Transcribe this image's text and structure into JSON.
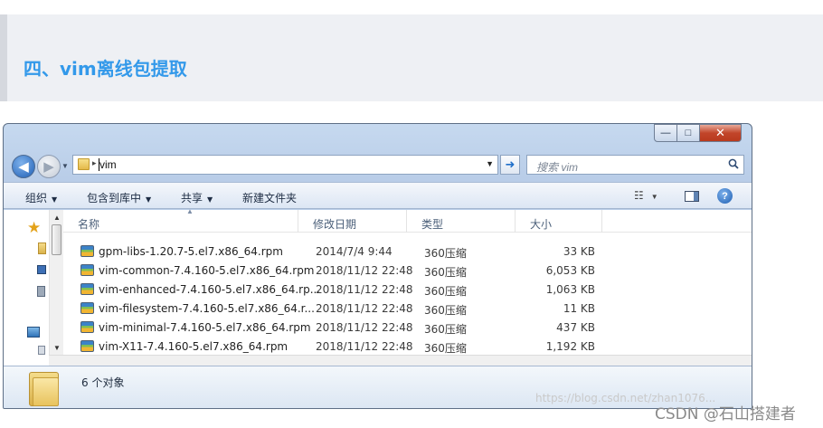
{
  "article": {
    "heading": "四、vim离线包提取"
  },
  "window": {
    "controls": {
      "minimize": "—",
      "maximize": "□",
      "close": "✕"
    },
    "address": {
      "path": "vim"
    },
    "search": {
      "placeholder": "搜索 vim"
    },
    "toolbar": {
      "organize": "组织",
      "include_in_library": "包含到库中",
      "share": "共享",
      "new_folder": "新建文件夹"
    },
    "columns": {
      "name": "名称",
      "modified": "修改日期",
      "type": "类型",
      "size": "大小"
    },
    "files": [
      {
        "name": "gpm-libs-1.20.7-5.el7.x86_64.rpm",
        "modified": "2014/7/4 9:44",
        "type": "360压缩",
        "size": "33 KB"
      },
      {
        "name": "vim-common-7.4.160-5.el7.x86_64.rpm",
        "modified": "2018/11/12 22:48",
        "type": "360压缩",
        "size": "6,053 KB"
      },
      {
        "name": "vim-enhanced-7.4.160-5.el7.x86_64.rp...",
        "modified": "2018/11/12 22:48",
        "type": "360压缩",
        "size": "1,063 KB"
      },
      {
        "name": "vim-filesystem-7.4.160-5.el7.x86_64.r...",
        "modified": "2018/11/12 22:48",
        "type": "360压缩",
        "size": "11 KB"
      },
      {
        "name": "vim-minimal-7.4.160-5.el7.x86_64.rpm",
        "modified": "2018/11/12 22:48",
        "type": "360压缩",
        "size": "437 KB"
      },
      {
        "name": "vim-X11-7.4.160-5.el7.x86_64.rpm",
        "modified": "2018/11/12 22:48",
        "type": "360压缩",
        "size": "1,192 KB"
      }
    ],
    "status": {
      "item_count": "6 个对象"
    }
  },
  "watermark": {
    "url": "https://blog.csdn.net/zhan1076...",
    "author": "CSDN @石山搭建者"
  },
  "colors": {
    "heading_text": "#3399ea",
    "heading_bg": "#eef0f4",
    "close_button": "#c2452a",
    "chrome": "#c6d9ef"
  },
  "icons": [
    "back-icon",
    "forward-icon",
    "folder-icon",
    "refresh-icon",
    "search-icon",
    "views-icon",
    "preview-pane-icon",
    "help-icon",
    "star-icon",
    "rpm-archive-icon"
  ]
}
